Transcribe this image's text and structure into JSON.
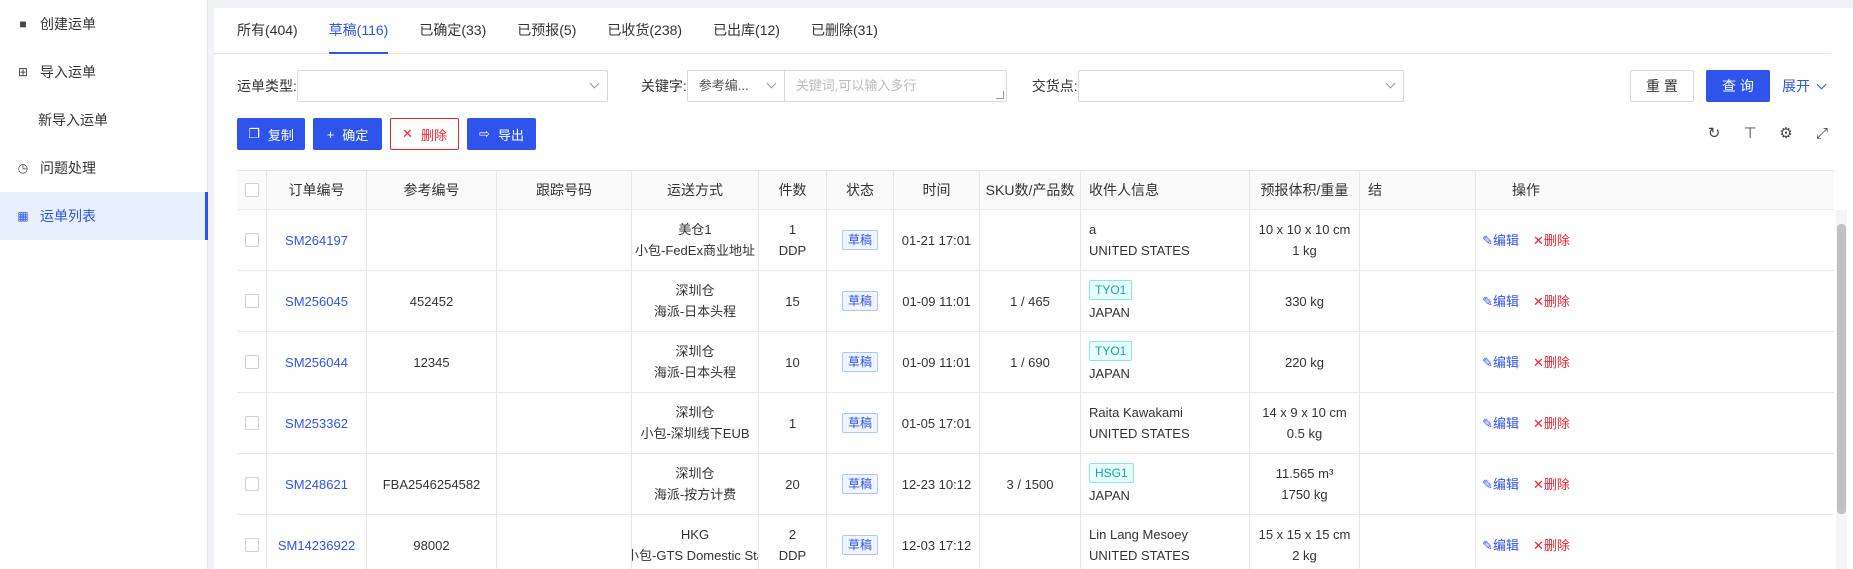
{
  "sidebar": {
    "items": [
      {
        "label": "创建运单",
        "icon": "box-icon"
      },
      {
        "label": "导入运单",
        "icon": "grid-icon"
      },
      {
        "label": "新导入运单",
        "icon": ""
      },
      {
        "label": "问题处理",
        "icon": "clock-icon"
      },
      {
        "label": "运单列表",
        "icon": "dashboard-icon",
        "active": true
      }
    ]
  },
  "tabs": [
    {
      "label": "所有(404)"
    },
    {
      "label": "草稿(116)",
      "active": true
    },
    {
      "label": "已确定(33)"
    },
    {
      "label": "已预报(5)"
    },
    {
      "label": "已收货(238)"
    },
    {
      "label": "已出库(12)"
    },
    {
      "label": "已删除(31)"
    }
  ],
  "filters": {
    "waybill_type_label": "运单类型:",
    "keyword_label": "关键字:",
    "keyword_field": "参考编...",
    "keyword_placeholder": "关键词,可以输入多行",
    "delivery_label": "交货点:",
    "reset": "重 置",
    "query": "查 询",
    "expand": "展开"
  },
  "actions": {
    "copy": "复制",
    "confirm": "确定",
    "delete": "删除",
    "export": "导出"
  },
  "table": {
    "headers": [
      "订单编号",
      "参考编号",
      "跟踪号码",
      "运送方式",
      "件数",
      "状态",
      "时间",
      "SKU数/产品数",
      "收件人信息",
      "预报体积/重量",
      "结",
      "操作"
    ],
    "rows": [
      {
        "order": "SM264197",
        "ref": "",
        "track": "",
        "ship1": "美仓1",
        "ship2": "小包-FedEx商业地址",
        "qty": "1",
        "qty2": "DDP",
        "status": "草稿",
        "time": "01-21 17:01",
        "sku": "",
        "tag": "",
        "r1": "a",
        "r2": "UNITED STATES",
        "v1": "10 x 10 x 10 cm",
        "v2": "1 kg",
        "edit": "编辑",
        "del": "删除"
      },
      {
        "order": "SM256045",
        "ref": "452452",
        "track": "",
        "ship1": "深圳仓",
        "ship2": "海派-日本头程",
        "qty": "15",
        "qty2": "",
        "status": "草稿",
        "time": "01-09 11:01",
        "sku": "1 / 465",
        "tag": "TYO1",
        "r1": "",
        "r2": "JAPAN",
        "v1": "330 kg",
        "v2": "",
        "edit": "编辑",
        "del": "删除"
      },
      {
        "order": "SM256044",
        "ref": "12345",
        "track": "",
        "ship1": "深圳仓",
        "ship2": "海派-日本头程",
        "qty": "10",
        "qty2": "",
        "status": "草稿",
        "time": "01-09 11:01",
        "sku": "1 / 690",
        "tag": "TYO1",
        "r1": "",
        "r2": "JAPAN",
        "v1": "220 kg",
        "v2": "",
        "edit": "编辑",
        "del": "删除"
      },
      {
        "order": "SM253362",
        "ref": "",
        "track": "",
        "ship1": "深圳仓",
        "ship2": "小包-深圳线下EUB",
        "qty": "1",
        "qty2": "",
        "status": "草稿",
        "time": "01-05 17:01",
        "sku": "",
        "tag": "",
        "r1": "Raita Kawakami",
        "r2": "UNITED STATES",
        "v1": "14 x 9 x 10 cm",
        "v2": "0.5 kg",
        "edit": "编辑",
        "del": "删除"
      },
      {
        "order": "SM248621",
        "ref": "FBA2546254582",
        "track": "",
        "ship1": "深圳仓",
        "ship2": "海派-按方计费",
        "qty": "20",
        "qty2": "",
        "status": "草稿",
        "time": "12-23 10:12",
        "sku": "3 / 1500",
        "tag": "HSG1",
        "r1": "",
        "r2": "JAPAN",
        "v1": "11.565 m³",
        "v2": "1750 kg",
        "edit": "编辑",
        "del": "删除"
      },
      {
        "order": "SM14236922",
        "ref": "98002",
        "track": "",
        "ship1": "HKG",
        "ship2": "小包-GTS Domestic Sta",
        "qty": "2",
        "qty2": "DDP",
        "status": "草稿",
        "time": "12-03 17:12",
        "sku": "",
        "tag": "",
        "r1": "Lin Lang Mesoey",
        "r2": "UNITED STATES",
        "v1": "15 x 15 x 15 cm",
        "v2": "2 kg",
        "edit": "编辑",
        "del": "删除"
      }
    ]
  },
  "colors": {
    "primary": "#2f54eb",
    "danger": "#f5222d",
    "tag_teal": "#13a8a8"
  }
}
